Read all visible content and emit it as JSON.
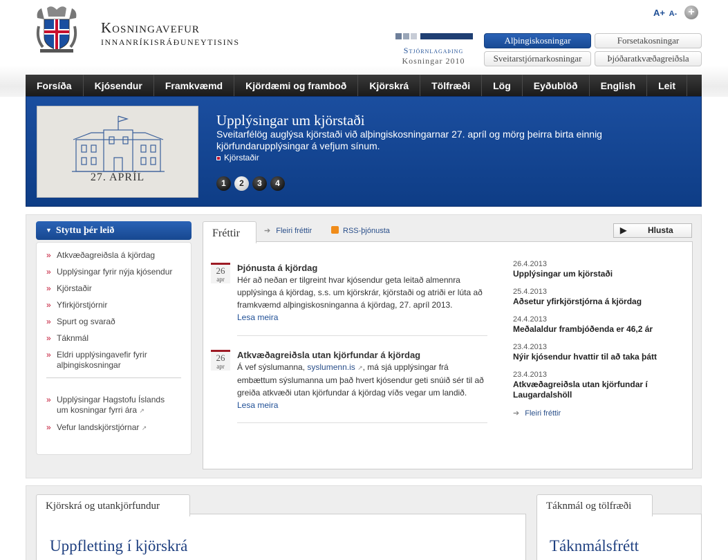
{
  "header": {
    "title_line1": "Kosningavefur",
    "title_line2": "innanríkisráðuneytisins",
    "font_increase": "A+",
    "font_decrease": "A-",
    "plus_icon": "+",
    "logo_line1": "Stjórnlagaþing",
    "logo_line2": "Kosningar 2010",
    "elections": [
      "Alþingiskosningar",
      "Forsetakosningar",
      "Sveitarstjórnarkosningar",
      "Þjóðaratkvæðagreiðsla"
    ]
  },
  "nav": [
    "Forsíða",
    "Kjósendur",
    "Framkvæmd",
    "Kjördæmi og framboð",
    "Kjörskrá",
    "Tölfræði",
    "Lög",
    "Eyðublöð",
    "English",
    "Leit"
  ],
  "banner": {
    "title": "Upplýsingar um kjörstaði",
    "text": "Sveitarfélög auglýsa kjörstaði við alþingiskosningarnar 27. apríl og mörg þeirra birta einnig kjörfundarupplýsingar á vefjum sínum.",
    "link": "Kjörstaðir",
    "image_caption": "27. APRÍL",
    "dots": [
      "1",
      "2",
      "3",
      "4"
    ],
    "active_dot": 1
  },
  "sidebar": {
    "title": "Styttu þér leið",
    "items": [
      "Atkvæðagreiðsla á kjördag",
      "Upplýsingar fyrir nýja kjósendur",
      "Kjörstaðir",
      "Yfirkjörstjórnir",
      "Spurt og svarað",
      "Táknmál",
      "Eldri upplýsingavefir fyrir alþingiskosningar"
    ],
    "external": [
      "Upplýsingar Hagstofu Íslands um kosningar fyrri ára",
      "Vefur landskjörstjórnar"
    ]
  },
  "news": {
    "tab": "Fréttir",
    "more_link": "Fleiri fréttir",
    "rss_link": "RSS-þjónusta",
    "listen": "Hlusta",
    "items": [
      {
        "day": "26",
        "month": "apr",
        "title": "Þjónusta á kjördag",
        "text": "Hér að neðan er tilgreint hvar kjósendur geta leitað almennra upplýsinga á kjördag, s.s. um kjörskrár, kjörstaði og atriði er lúta að framkvæmd alþingiskosninganna á kjördag, 27. apríl 2013.",
        "more": "Lesa meira"
      },
      {
        "day": "26",
        "month": "apr",
        "title": "Atkvæðagreiðsla utan kjörfundar á kjördag",
        "text_before": "Á vef sýslumanna,",
        "text_link": "syslumenn.is",
        "text_after": ", má sjá upplýsingar frá embættum sýslumanna um það hvert kjósendur geti snúið sér til að greiða atkvæði utan kjörfundar á kjördag víðs vegar um landið.",
        "more": "Lesa meira"
      }
    ],
    "recent": [
      {
        "date": "26.4.2013",
        "title": "Upplýsingar um kjörstaði"
      },
      {
        "date": "25.4.2013",
        "title": "Aðsetur yfirkjörstjórna á kjördag"
      },
      {
        "date": "24.4.2013",
        "title": "Meðalaldur frambjóðenda er 46,2 ár"
      },
      {
        "date": "23.4.2013",
        "title": "Nýir kjósendur hvattir til að taka þátt"
      },
      {
        "date": "23.4.2013",
        "title": "Atkvæðagreiðsla utan kjörfundar í Laugardalshöll"
      }
    ],
    "recent_more": "Fleiri fréttir"
  },
  "bottom": {
    "tab_left": "Kjörskrá og utankjörfundur",
    "tab_right": "Táknmál og tölfræði",
    "heading_left": "Uppfletting í kjörskrá",
    "heading_right": "Táknmálsfrétt"
  },
  "colors": {
    "brand_blue": "#1f4f96",
    "nav_dark": "#222222",
    "accent_red": "#c0102f"
  }
}
